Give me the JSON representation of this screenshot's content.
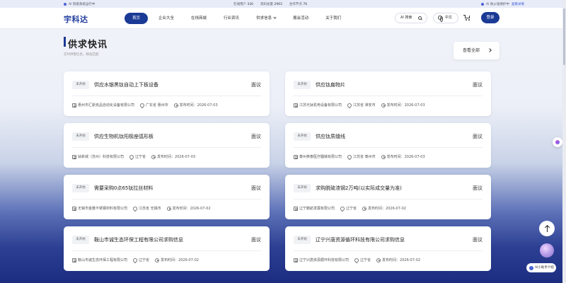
{
  "topbar": {
    "notice": "AI 智能系统运行中",
    "stats": [
      {
        "label": "在线用户",
        "value": "330"
      },
      {
        "label": "资料总量",
        "value": "2963"
      },
      {
        "label": "合作节点",
        "value": "76"
      }
    ],
    "security": "AI 防火墙保护中",
    "security_link": "查看详情"
  },
  "navbar": {
    "logo": "宇科达",
    "items": [
      {
        "label": "首页",
        "active": true
      },
      {
        "label": "企业大全"
      },
      {
        "label": "在线商城"
      },
      {
        "label": "行业资讯"
      },
      {
        "label": "供求信息",
        "dropdown": true
      },
      {
        "label": "展会活动"
      },
      {
        "label": "关于我们"
      }
    ],
    "ai_search": "AI 搜索",
    "lang": "中文",
    "login": "登录"
  },
  "section": {
    "title": "供求快讯",
    "subtitle": "实时供需信息，精准匹配",
    "view_all": "查看全部"
  },
  "cards": [
    {
      "status": "未开始",
      "title": "供应水银黑钛自动上下板设备",
      "price": "面议",
      "company": "惠州市汇斯克品自动化设备有限公司",
      "location": "广东省 惠州市",
      "date": "发布时间：2026-07-03"
    },
    {
      "status": "未开始",
      "title": "供应钛扁物片",
      "price": "面议",
      "company": "江苏光钛机电设备有限公司",
      "location": "江苏省 淮安市",
      "date": "发布时间：2026-07-03"
    },
    {
      "status": "未开始",
      "title": "供应生物机钛阳极座弧形板",
      "price": "面议",
      "company": "钛新城（苏州）科技有限公司",
      "location": "辽宁省",
      "date": "发布时间：2026-07-03"
    },
    {
      "status": "未开始",
      "title": "供应钛质缝线",
      "price": "面议",
      "company": "泰州英泰医疗器械有限公司",
      "location": "江苏省 泰州市",
      "date": "发布时间：2026-07-03"
    },
    {
      "status": "未开始",
      "title": "需要采购0点65钛拉丝材料",
      "price": "面议",
      "company": "无锡市金雅不锈钢材料有限公司",
      "location": "江苏省 无锡市",
      "date": "发布时间：2026-07-02"
    },
    {
      "status": "未开始",
      "title": "求购脱硫渣钢2万吨(以实际成交量为准)",
      "price": "面议",
      "company": "辽宁鹏航发展有限公司",
      "location": "辽宁省",
      "date": "发布时间：2026-07-02"
    },
    {
      "status": "未开始",
      "title": "鞍山市诚生态环保工程有限公司求购信息",
      "price": "面议",
      "company": "鞍山市诚生态环保工程有限公司",
      "location": "辽宁省",
      "date": "发布时间：2026-07-02"
    },
    {
      "status": "未开始",
      "title": "辽宁兴唐资源循环科技有限公司求购信息",
      "price": "面议",
      "company": "辽宁兴唐资源循环科技有限公司",
      "location": "辽宁省",
      "date": "发布时间：2026-07-02"
    }
  ],
  "floating": {
    "assistant": "AI小助手介绍"
  }
}
